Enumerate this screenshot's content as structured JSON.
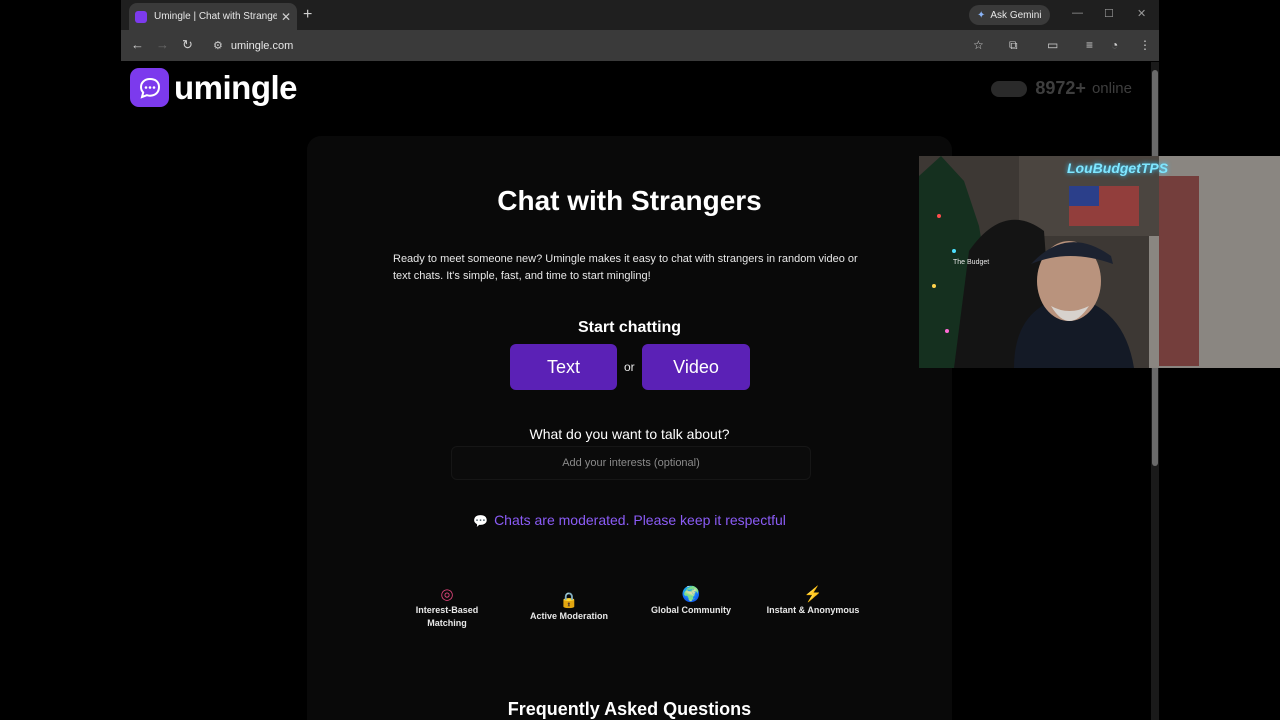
{
  "browser": {
    "tab_title": "Umingle | Chat with Strangers i",
    "ask_gemini": "Ask Gemini",
    "url": "umingle.com"
  },
  "site": {
    "logo_text": "umingle",
    "online_count": "8972+",
    "online_label": "online"
  },
  "hero": {
    "title": "Chat with Strangers",
    "intro": "Ready to meet someone new? Umingle makes it easy to chat with strangers in random video or text chats. It's simple, fast, and time to start mingling!",
    "start_label": "Start chatting",
    "text_button": "Text",
    "or_label": "or",
    "video_button": "Video",
    "talk_label": "What do you want to talk about?",
    "interest_placeholder": "Add your interests (optional)",
    "moderation_note": "Chats are moderated. Please keep it respectful"
  },
  "features": [
    {
      "icon": "target-icon",
      "label": "Interest-Based Matching"
    },
    {
      "icon": "lock-icon",
      "label": "Active Moderation"
    },
    {
      "icon": "globe-icon",
      "label": "Global Community"
    },
    {
      "icon": "lightning-icon",
      "label": "Instant & Anonymous"
    }
  ],
  "faq_title": "Frequently Asked Questions",
  "webcam_overlay": {
    "neon_sign": "LouBudgetTPS",
    "sign_label": "The Budget"
  },
  "colors": {
    "accent": "#5b21b6",
    "logo": "#7c3aed",
    "moderation_text": "#8b5cf6"
  }
}
